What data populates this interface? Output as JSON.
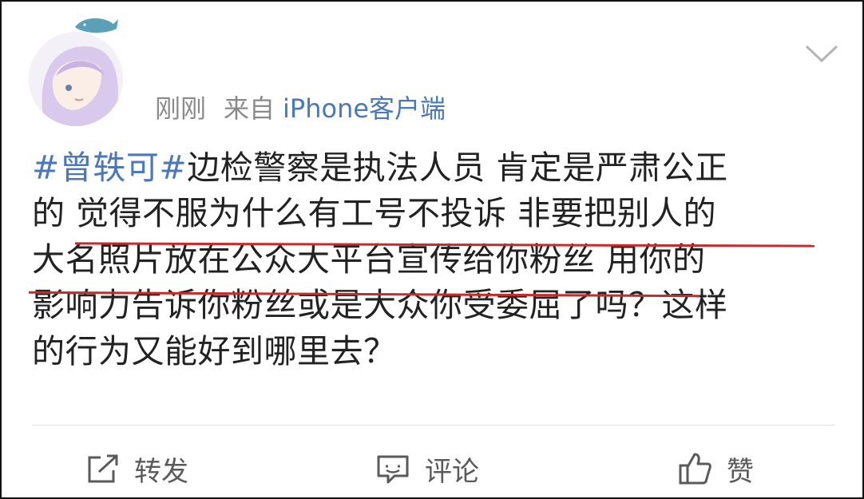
{
  "meta": {
    "time": "刚刚",
    "from_label": "来自",
    "source": "iPhone客户端"
  },
  "post": {
    "hashtag": "#曾轶可#",
    "lines": [
      "边检警察是执法人员 肯定是严肃公正",
      "的 觉得不服为什么有工号不投诉 非要把别人的",
      "大名照片放在公众大平台宣传给你粉丝 用你的",
      "影响力告诉你粉丝或是大众你受委屈了吗？这样",
      "的行为又能好到哪里去？"
    ]
  },
  "actions": {
    "repost": "转发",
    "comment": "评论",
    "like": "赞"
  },
  "icons": {
    "repost": "share-icon",
    "comment": "comment-icon",
    "like": "thumbs-up-icon",
    "menu": "chevron-down-icon"
  },
  "colors": {
    "link": "#4a78b8",
    "underline": "#c72c2c",
    "meta": "#8a8a8a"
  }
}
